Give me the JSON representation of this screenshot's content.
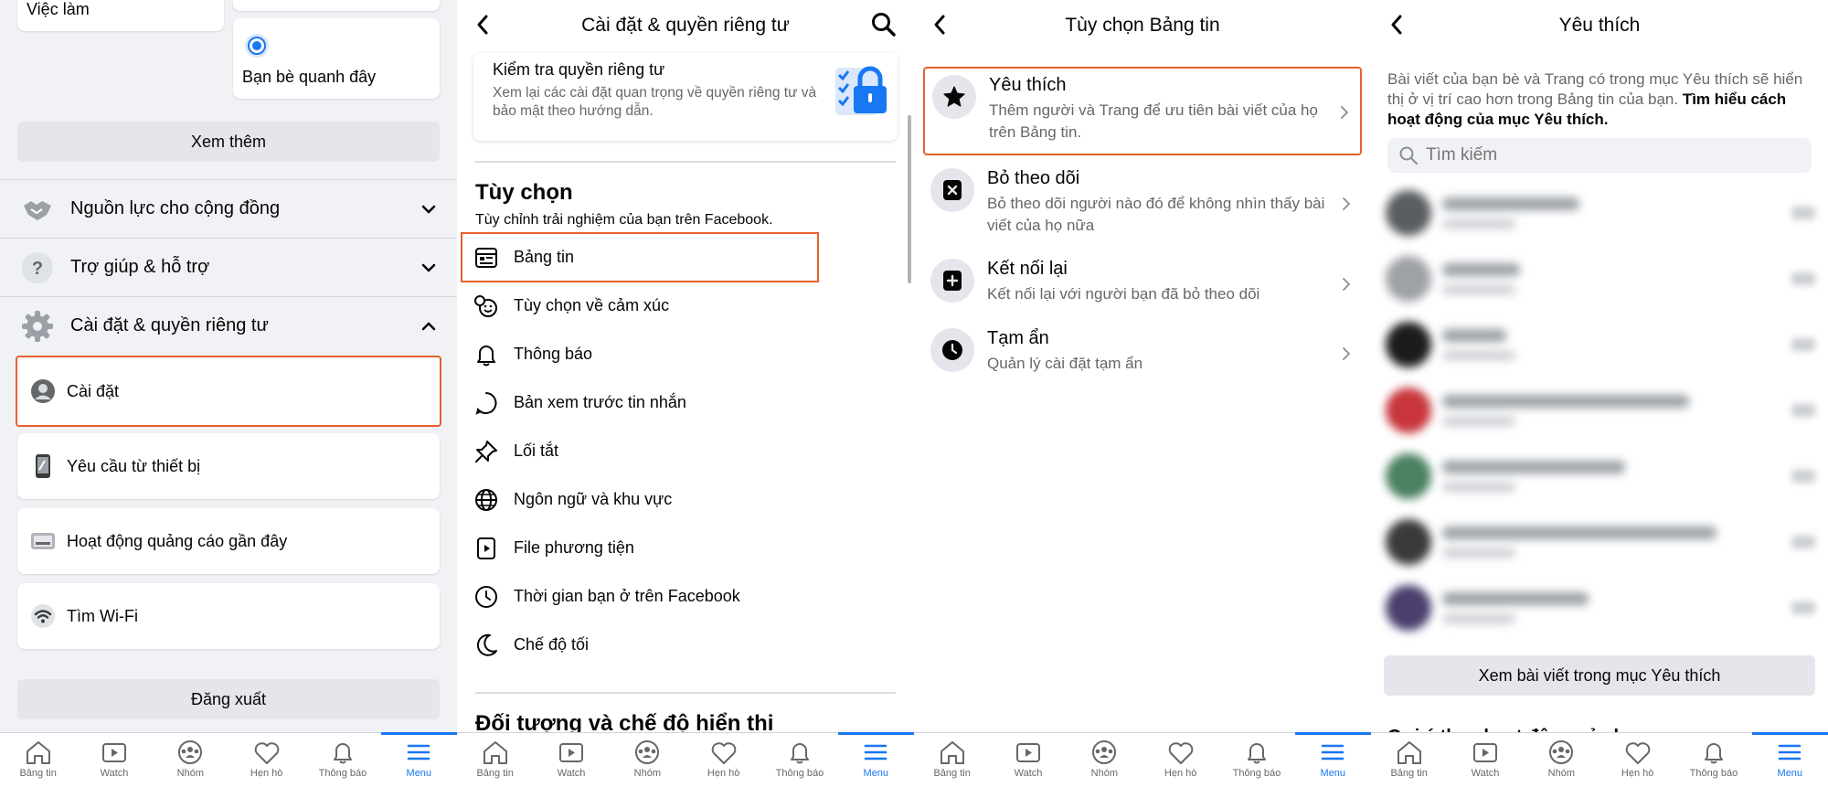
{
  "bottom_nav": {
    "items": [
      {
        "label": "Bảng tin",
        "icon": "home-icon"
      },
      {
        "label": "Watch",
        "icon": "watch-icon"
      },
      {
        "label": "Nhóm",
        "icon": "groups-icon"
      },
      {
        "label": "Hẹn hò",
        "icon": "dating-heart-icon"
      },
      {
        "label": "Thông báo",
        "icon": "bell-icon"
      },
      {
        "label": "Menu",
        "icon": "menu-icon",
        "active": true
      }
    ]
  },
  "panel1": {
    "top_card_left": "Việc làm",
    "top_card_right": "Bạn bè quanh đây",
    "see_more": "Xem thêm",
    "sections": [
      {
        "label": "Nguồn lực cho cộng đồng",
        "icon": "handshake-icon"
      },
      {
        "label": "Trợ giúp & hỗ trợ",
        "icon": "help-icon"
      },
      {
        "label": "Cài đặt & quyền riêng tư",
        "icon": "gear-icon"
      }
    ],
    "settings_items": [
      {
        "label": "Cài đặt",
        "icon": "user-settings-icon"
      },
      {
        "label": "Yêu cầu từ thiết bị",
        "icon": "device-icon"
      },
      {
        "label": "Hoạt động quảng cáo gần đây",
        "icon": "ad-activity-icon"
      },
      {
        "label": "Tìm Wi-Fi",
        "icon": "wifi-icon"
      }
    ],
    "logout": "Đăng xuất"
  },
  "panel2": {
    "title": "Cài đặt & quyền riêng tư",
    "privacy_check_title": "Kiểm tra quyền riêng tư",
    "privacy_check_desc": "Xem lại các cài đặt quan trọng về quyền riêng tư và bảo mật theo hướng dẫn.",
    "options_heading": "Tùy chọn",
    "options_sub": "Tùy chỉnh trải nghiệm của bạn trên Facebook.",
    "menu": [
      {
        "label": "Bảng tin",
        "icon": "news-feed-icon"
      },
      {
        "label": "Tùy chọn về cảm xúc",
        "icon": "reactions-icon"
      },
      {
        "label": "Thông báo",
        "icon": "bell-icon"
      },
      {
        "label": "Bản xem trước tin nhắn",
        "icon": "message-preview-icon"
      },
      {
        "label": "Lối tắt",
        "icon": "pin-icon"
      },
      {
        "label": "Ngôn ngữ và khu vực",
        "icon": "globe-icon"
      },
      {
        "label": "File phương tiện",
        "icon": "media-file-icon"
      },
      {
        "label": "Thời gian bạn ở trên Facebook",
        "icon": "clock-icon"
      },
      {
        "label": "Chế độ tối",
        "icon": "moon-icon"
      }
    ],
    "audience_heading": "Đối tượng và chế độ hiển thị"
  },
  "panel3": {
    "title": "Tùy chọn Bảng tin",
    "options": [
      {
        "title": "Yêu thích",
        "desc": "Thêm người và Trang để ưu tiên bài viết của họ trên Bảng tin.",
        "icon": "star-icon"
      },
      {
        "title": "Bỏ theo dõi",
        "desc": "Bỏ theo dõi người nào đó để không nhìn thấy bài viết của họ nữa",
        "icon": "unfollow-icon"
      },
      {
        "title": "Kết nối lại",
        "desc": "Kết nối lại với người bạn đã bỏ theo dõi",
        "icon": "reconnect-icon"
      },
      {
        "title": "Tạm ẩn",
        "desc": "Quản lý cài đặt tạm ẩn",
        "icon": "snooze-clock-icon"
      }
    ]
  },
  "panel4": {
    "title": "Yêu thích",
    "intro": "Bài viết của bạn bè và Trang có trong mục Yêu thích sẽ hiển thị ở vị trí cao hơn trong Bảng tin của bạn.",
    "intro_link": "Tìm hiểu cách hoạt động của mục Yêu thích.",
    "search_placeholder": "Tìm kiếm",
    "view_button": "Xem bài viết trong mục Yêu thích",
    "suggest_heading": "Gợi ý theo hoạt động của bạn"
  },
  "colors": {
    "accent": "#1877f2",
    "highlight": "#e8602c",
    "background": "#f0f2f5",
    "fav_avatars": [
      "#5a5d62",
      "#9ea1a6",
      "#1c1c1c",
      "#c8363c",
      "#4b8060",
      "#3a3a3a",
      "#4a3f6e"
    ]
  }
}
